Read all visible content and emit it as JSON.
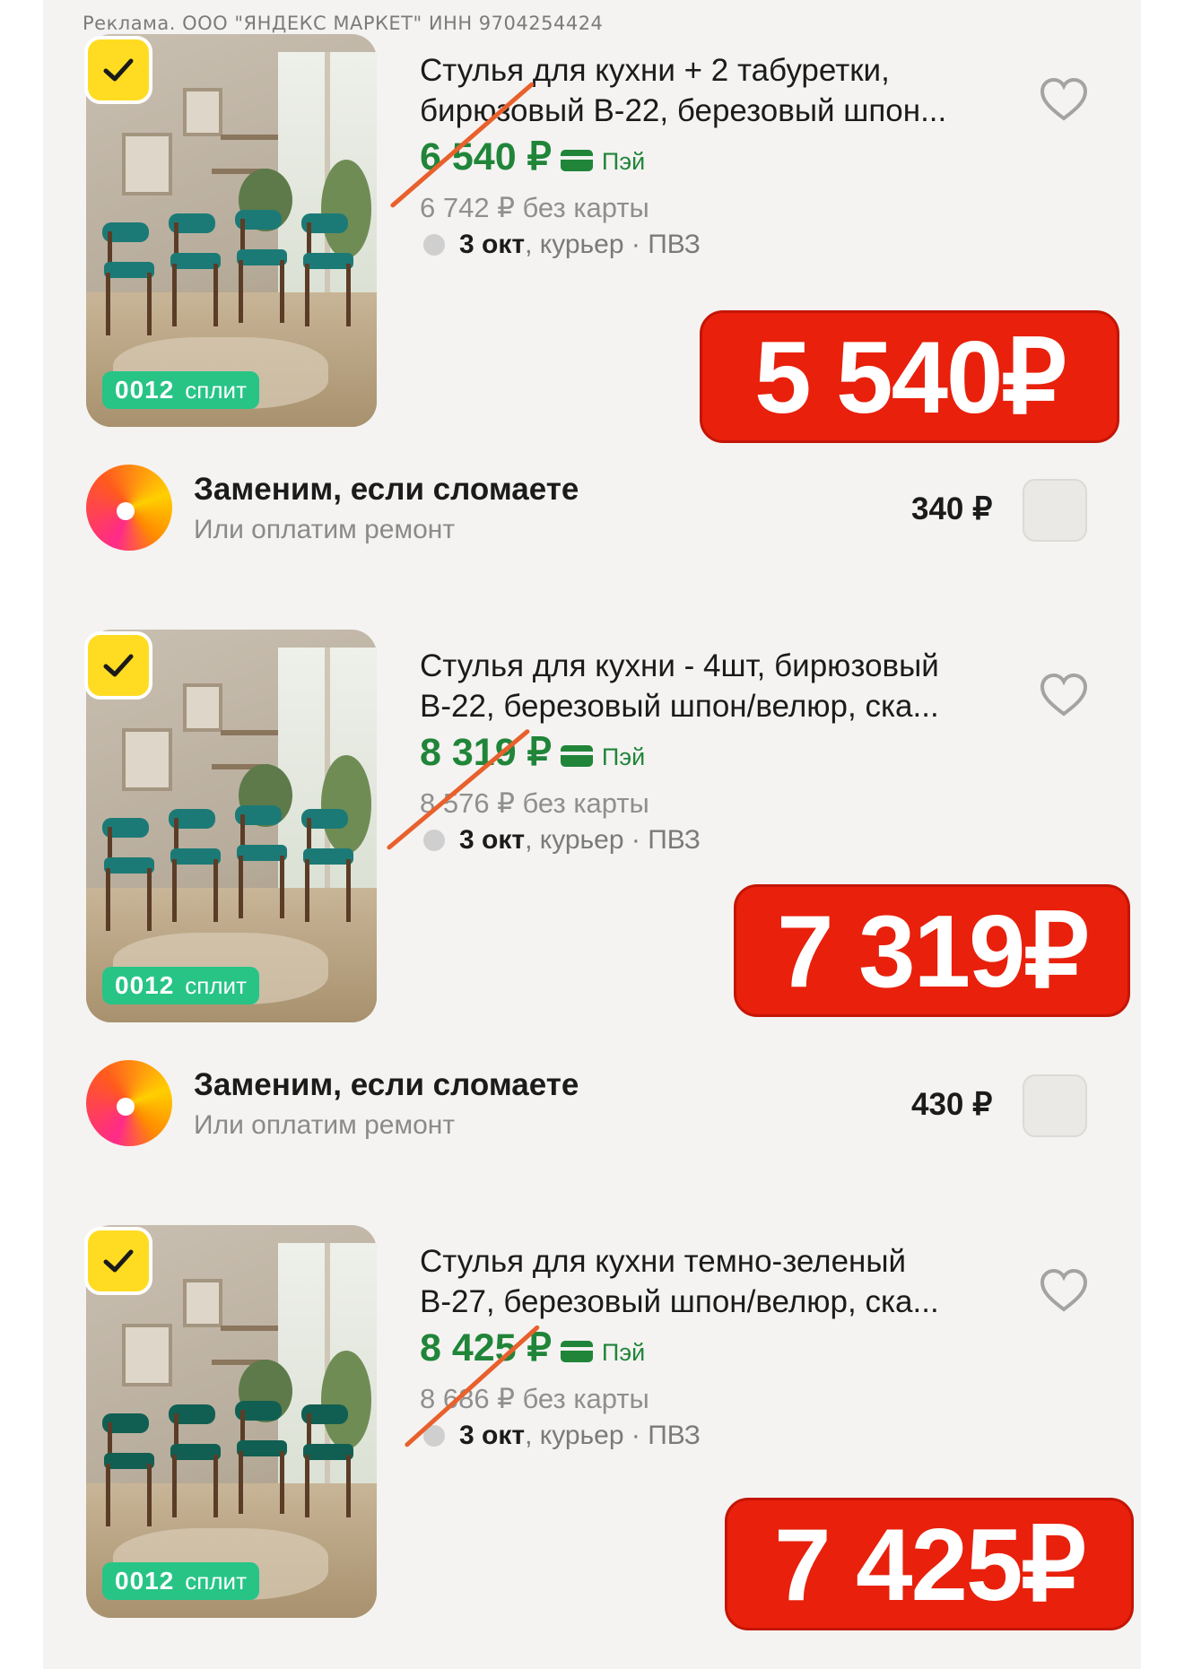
{
  "ad_label": "Реклама. ООО \"ЯНДЕКС МАРКЕТ\" ИНН 9704254424",
  "colors": {
    "accent_red": "#e8200c",
    "price_green": "#208539",
    "split_green": "#27c486",
    "badge_yellow": "#ffdc22"
  },
  "products": [
    {
      "title_line1": "Стулья для кухни + 2 табуретки,",
      "title_line2": "бирюзовый В-22, березовый шпон...",
      "price_green": "6 540 ₽",
      "pay_label": "Пэй",
      "old_price": "6 742 ₽  без карты",
      "delivery_date": "3 окт",
      "delivery_rest": ", курьер · ПВЗ",
      "split_code": "0012",
      "split_label": "сплит",
      "big_price": "5 540₽",
      "seat_color": "#1c7a76",
      "service": {
        "title": "Заменим, если сломаете",
        "subtitle": "Или оплатим ремонт",
        "price": "340 ₽"
      }
    },
    {
      "title_line1": "Стулья для кухни - 4шт, бирюзовый",
      "title_line2": "В-22, березовый шпон/велюр, ска...",
      "price_green": "8 319 ₽",
      "pay_label": "Пэй",
      "old_price": "8 576 ₽  без карты",
      "delivery_date": "3 окт",
      "delivery_rest": ", курьер · ПВЗ",
      "split_code": "0012",
      "split_label": "сплит",
      "big_price": "7 319₽",
      "seat_color": "#1c7a76",
      "service": {
        "title": "Заменим, если сломаете",
        "subtitle": "Или оплатим ремонт",
        "price": "430 ₽"
      }
    },
    {
      "title_line1": "Стулья для кухни темно-зеленый",
      "title_line2": "В-27, березовый шпон/велюр, ска...",
      "price_green": "8 425 ₽",
      "pay_label": "Пэй",
      "old_price": "8 686 ₽  без карты",
      "delivery_date": "3 окт",
      "delivery_rest": ", курьер · ПВЗ",
      "split_code": "0012",
      "split_label": "сплит",
      "big_price": "7 425₽",
      "seat_color": "#115f52"
    }
  ]
}
